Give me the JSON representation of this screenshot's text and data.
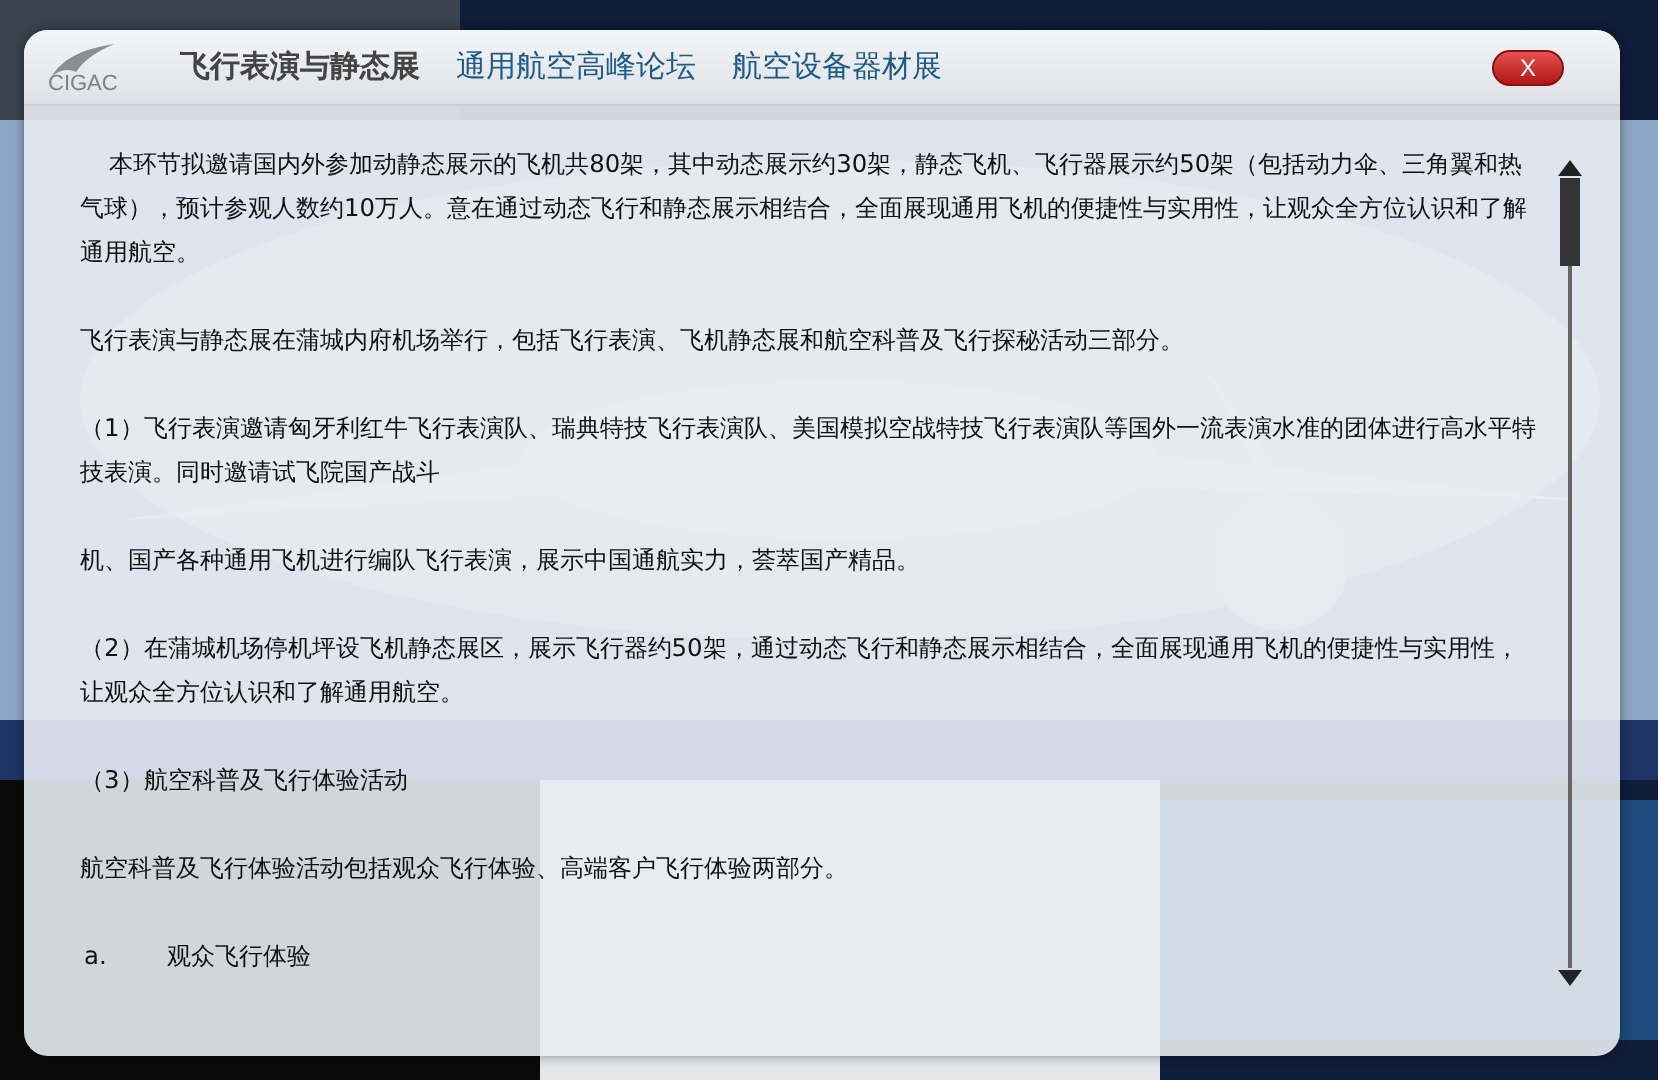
{
  "dialog": {
    "logo": "CIGAC",
    "tabs": [
      {
        "label": "飞行表演与静态展",
        "selected": true
      },
      {
        "label": "通用航空高峰论坛",
        "selected": false
      },
      {
        "label": "航空设备器材展",
        "selected": false
      }
    ],
    "close": "X",
    "paragraphs": [
      {
        "kind": "text",
        "text": "本环节拟邀请国内外参加动静态展示的飞机共80架，其中动态展示约30架，静态飞机、飞行器展示约50架（包括动力伞、三角翼和热气球），预计参观人数约10万人。意在通过动态飞行和静态展示相结合，全面展现通用飞机的便捷性与实用性，让观众全方位认识和了解通用航空。",
        "indent": true
      },
      {
        "kind": "text",
        "text": "飞行表演与静态展在蒲城内府机场举行，包括飞行表演、飞机静态展和航空科普及飞行探秘活动三部分。",
        "indent": false
      },
      {
        "kind": "text",
        "text": "（1）飞行表演邀请匈牙利红牛飞行表演队、瑞典特技飞行表演队、美国模拟空战特技飞行表演队等国外一流表演水准的团体进行高水平特技表演。同时邀请试飞院国产战斗",
        "indent": false
      },
      {
        "kind": "text",
        "text": "机、国产各种通用飞机进行编队飞行表演，展示中国通航实力，荟萃国产精品。",
        "indent": false
      },
      {
        "kind": "text",
        "text": "（2）在蒲城机场停机坪设飞机静态展区，展示飞行器约50架，通过动态飞行和静态展示相结合，全面展现通用飞机的便捷性与实用性，让观众全方位认识和了解通用航空。",
        "indent": false
      },
      {
        "kind": "text",
        "text": "（3）航空科普及飞行体验活动",
        "indent": false
      },
      {
        "kind": "text",
        "text": "航空科普及飞行体验活动包括观众飞行体验、高端客户飞行体验两部分。",
        "indent": false
      },
      {
        "kind": "list-item",
        "marker": "a.",
        "text": "观众飞行体验"
      }
    ]
  }
}
